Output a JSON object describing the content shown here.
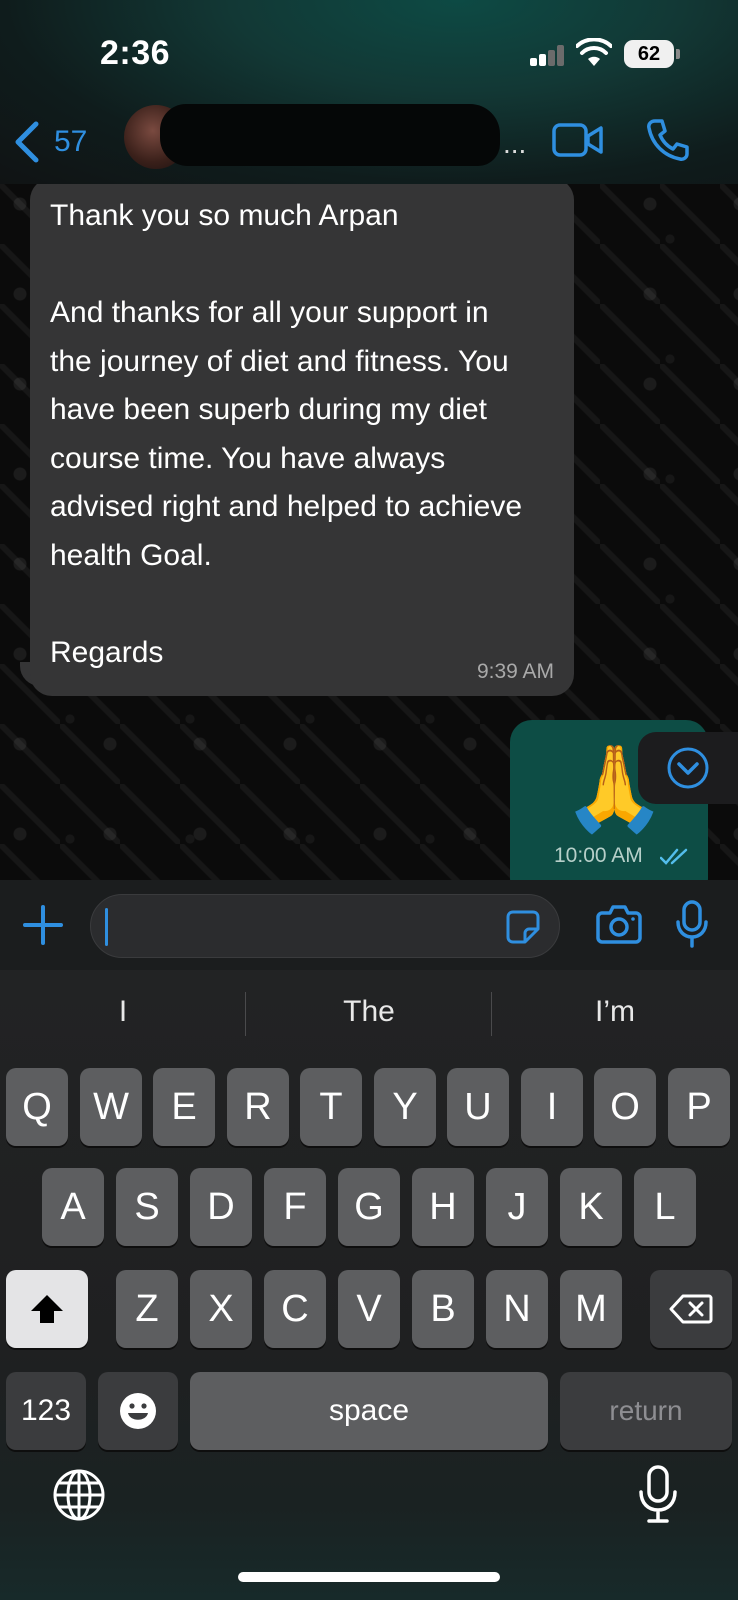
{
  "status_bar": {
    "time": "2:36",
    "battery": "62"
  },
  "header": {
    "back_count": "57",
    "ellipsis": "..."
  },
  "messages": {
    "incoming": {
      "text": "Thank you so much Arpan\n\nAnd thanks for all your support in\nthe journey of diet and fitness. You\nhave been superb during my diet\ncourse time. You have always\nadvised right and helped to achieve\nhealth Goal.\n\nRegards",
      "time": "9:39 AM"
    },
    "outgoing": {
      "emoji": "🙏",
      "time": "10:00 AM",
      "status": "read"
    }
  },
  "input": {
    "value": ""
  },
  "keyboard": {
    "suggestions": [
      "I",
      "The",
      "I’m"
    ],
    "row1": [
      "Q",
      "W",
      "E",
      "R",
      "T",
      "Y",
      "U",
      "I",
      "O",
      "P"
    ],
    "row2": [
      "A",
      "S",
      "D",
      "F",
      "G",
      "H",
      "J",
      "K",
      "L"
    ],
    "row3": [
      "Z",
      "X",
      "C",
      "V",
      "B",
      "N",
      "M"
    ],
    "numbers_label": "123",
    "space_label": "space",
    "return_label": "return"
  },
  "colors": {
    "accent": "#2f8fe0",
    "incoming_bubble": "#353536",
    "outgoing_bubble": "#0d4d45"
  },
  "icons": [
    "back-chevron-icon",
    "video-call-icon",
    "phone-icon",
    "chevron-down-circle-icon",
    "plus-icon",
    "sticker-icon",
    "camera-icon",
    "microphone-icon",
    "shift-icon",
    "backspace-icon",
    "emoji-icon",
    "globe-icon",
    "dictation-icon",
    "double-check-icon"
  ]
}
